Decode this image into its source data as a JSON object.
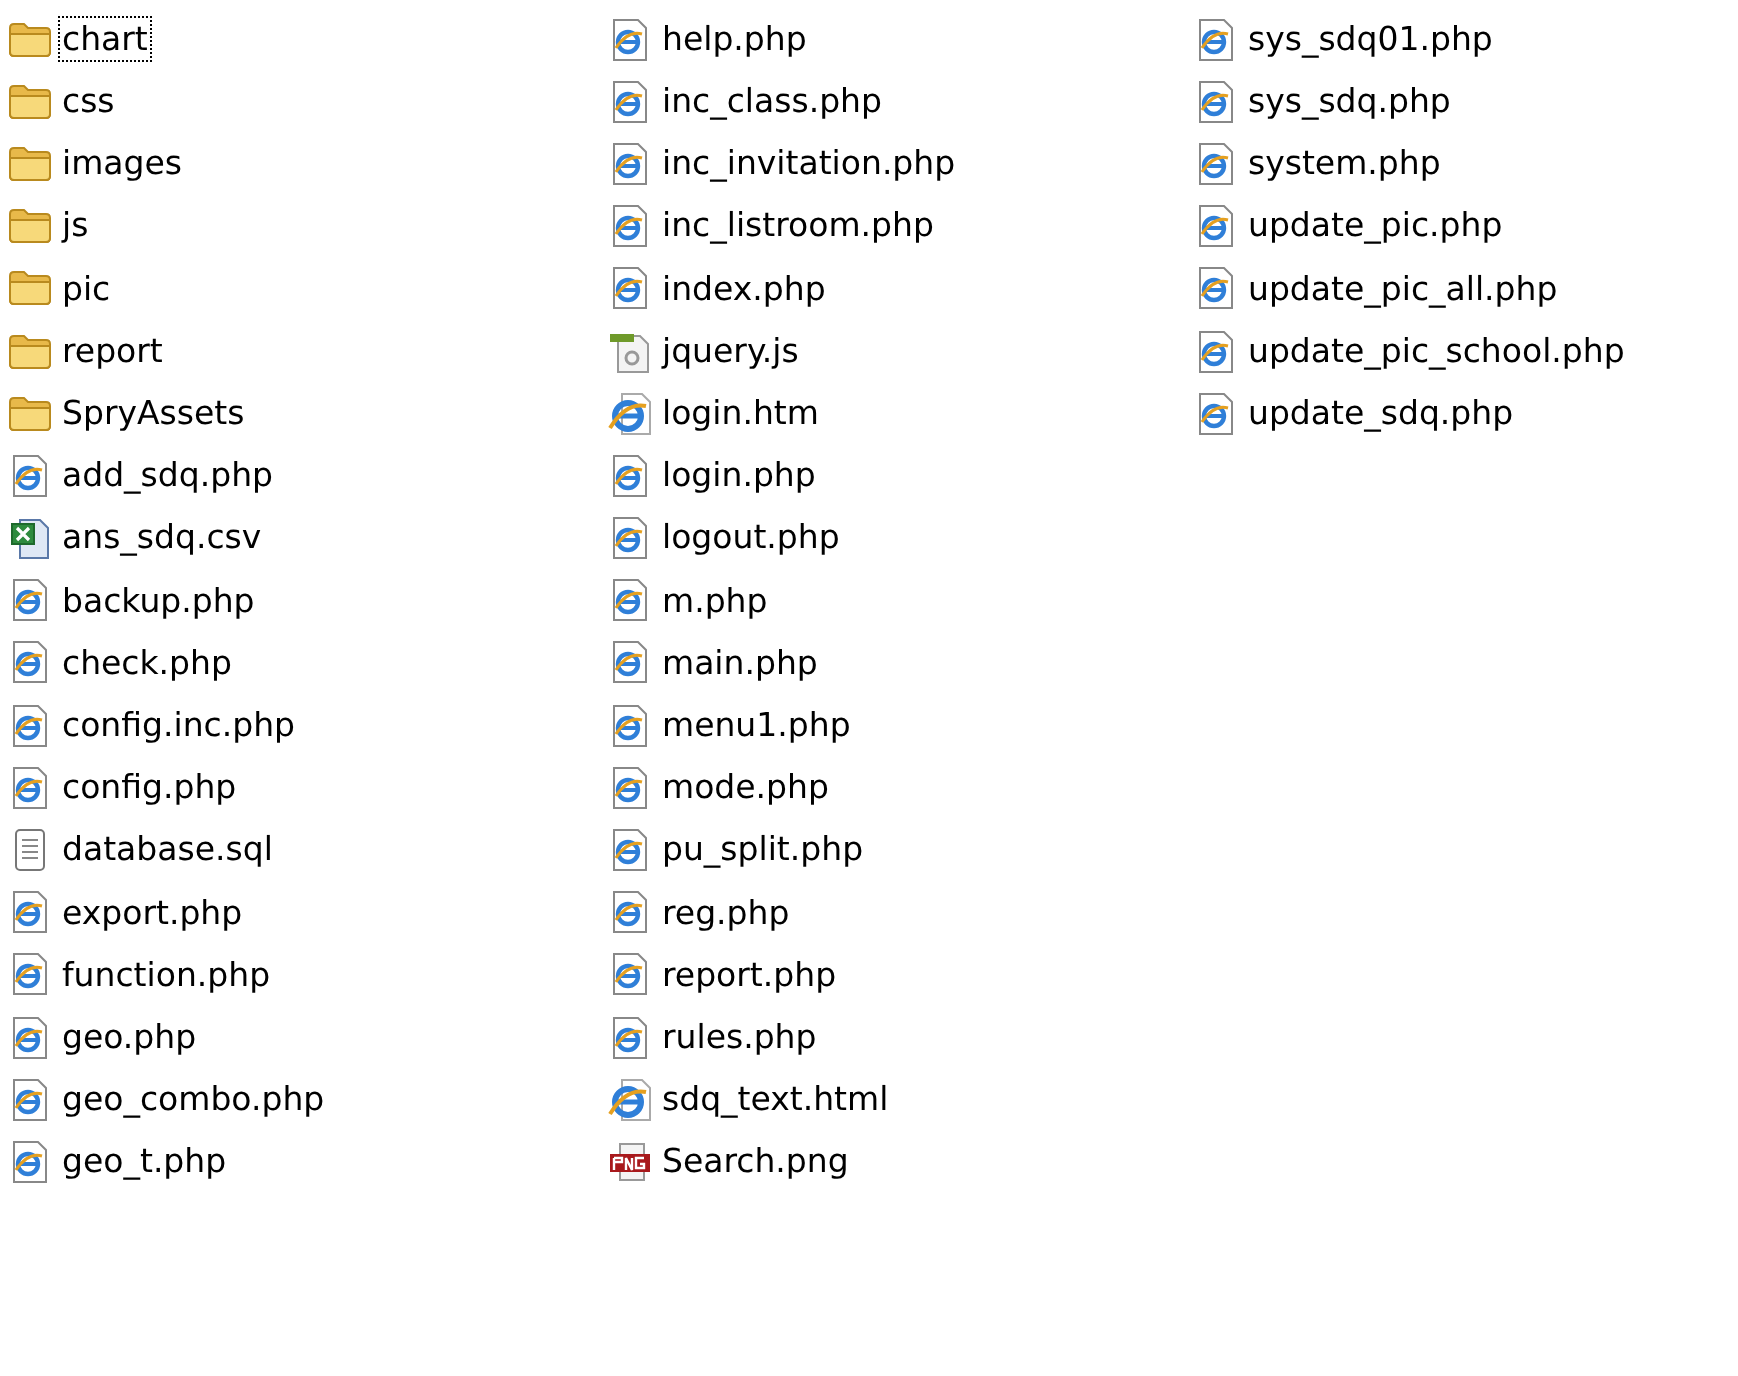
{
  "columns": [
    [
      {
        "name": "chart",
        "kind": "folder",
        "focused": true
      },
      {
        "name": "css",
        "kind": "folder",
        "focused": false
      },
      {
        "name": "images",
        "kind": "folder",
        "focused": false
      },
      {
        "name": "js",
        "kind": "folder",
        "focused": false
      },
      {
        "name": "pic",
        "kind": "folder",
        "focused": false
      },
      {
        "name": "report",
        "kind": "folder",
        "focused": false
      },
      {
        "name": "SpryAssets",
        "kind": "folder",
        "focused": false
      },
      {
        "name": "add_sdq.php",
        "kind": "php",
        "focused": false
      },
      {
        "name": "ans_sdq.csv",
        "kind": "csv",
        "focused": false
      },
      {
        "name": "backup.php",
        "kind": "php",
        "focused": false
      },
      {
        "name": "check.php",
        "kind": "php",
        "focused": false
      },
      {
        "name": "config.inc.php",
        "kind": "php",
        "focused": false
      },
      {
        "name": "config.php",
        "kind": "php",
        "focused": false
      },
      {
        "name": "database.sql",
        "kind": "text",
        "focused": false
      },
      {
        "name": "export.php",
        "kind": "php",
        "focused": false
      },
      {
        "name": "function.php",
        "kind": "php",
        "focused": false
      },
      {
        "name": "geo.php",
        "kind": "php",
        "focused": false
      },
      {
        "name": "geo_combo.php",
        "kind": "php",
        "focused": false
      },
      {
        "name": "geo_t.php",
        "kind": "php",
        "focused": false
      }
    ],
    [
      {
        "name": "help.php",
        "kind": "php",
        "focused": false
      },
      {
        "name": "inc_class.php",
        "kind": "php",
        "focused": false
      },
      {
        "name": "inc_invitation.php",
        "kind": "php",
        "focused": false
      },
      {
        "name": "inc_listroom.php",
        "kind": "php",
        "focused": false
      },
      {
        "name": "index.php",
        "kind": "php",
        "focused": false
      },
      {
        "name": "jquery.js",
        "kind": "script",
        "focused": false
      },
      {
        "name": "login.htm",
        "kind": "html",
        "focused": false
      },
      {
        "name": "login.php",
        "kind": "php",
        "focused": false
      },
      {
        "name": "logout.php",
        "kind": "php",
        "focused": false
      },
      {
        "name": "m.php",
        "kind": "php",
        "focused": false
      },
      {
        "name": "main.php",
        "kind": "php",
        "focused": false
      },
      {
        "name": "menu1.php",
        "kind": "php",
        "focused": false
      },
      {
        "name": "mode.php",
        "kind": "php",
        "focused": false
      },
      {
        "name": "pu_split.php",
        "kind": "php",
        "focused": false
      },
      {
        "name": "reg.php",
        "kind": "php",
        "focused": false
      },
      {
        "name": "report.php",
        "kind": "php",
        "focused": false
      },
      {
        "name": "rules.php",
        "kind": "php",
        "focused": false
      },
      {
        "name": "sdq_text.html",
        "kind": "html",
        "focused": false
      },
      {
        "name": "Search.png",
        "kind": "image",
        "focused": false
      }
    ],
    [
      {
        "name": "sys_sdq01.php",
        "kind": "php",
        "focused": false
      },
      {
        "name": "sys_sdq.php",
        "kind": "php",
        "focused": false
      },
      {
        "name": "system.php",
        "kind": "php",
        "focused": false
      },
      {
        "name": "update_pic.php",
        "kind": "php",
        "focused": false
      },
      {
        "name": "update_pic_all.php",
        "kind": "php",
        "focused": false
      },
      {
        "name": "update_pic_school.php",
        "kind": "php",
        "focused": false
      },
      {
        "name": "update_sdq.php",
        "kind": "php",
        "focused": false
      }
    ]
  ]
}
